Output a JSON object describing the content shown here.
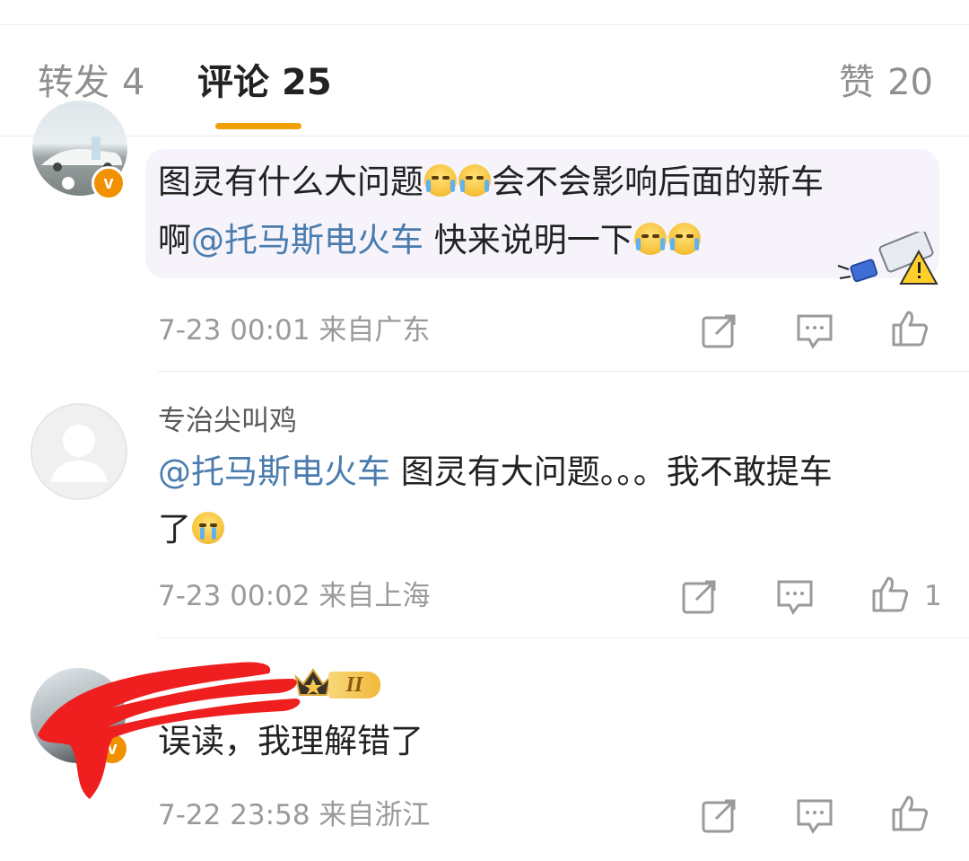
{
  "tabs": {
    "repost_label": "转发",
    "repost_count": "4",
    "comment_label": "评论",
    "comment_count": "25",
    "like_label": "赞",
    "like_count": "20"
  },
  "comments": [
    {
      "text_line1_a": "图灵有什么大问题",
      "text_line1_b": "会不会影响后面的新车",
      "text_line2_a": "啊",
      "mention": "@托马斯电火车",
      "text_line2_b": " 快来说明一下",
      "time": "7-23 00:01",
      "location": "来自广东",
      "emoji_line1": "laughing-crying-emoji",
      "emoji_line2": "cover-mouth-crying-emoji"
    },
    {
      "username": "专治尖叫鸡",
      "mention": "@托马斯电火车",
      "text_line1": " 图灵有大问题。。。我不敢提车",
      "text_line2": "了",
      "time": "7-23 00:02",
      "location": "来自上海",
      "likes": "1",
      "emoji_line2": "crying-emoji"
    },
    {
      "text": "误读，我理解错了",
      "time": "7-22 23:58",
      "location": "来自浙江",
      "badge_level": "II"
    }
  ],
  "colors": {
    "accent": "#f2a007",
    "mention": "#4a7cae",
    "meta": "#9a9a9a",
    "bubble": "#f6f3fb"
  }
}
